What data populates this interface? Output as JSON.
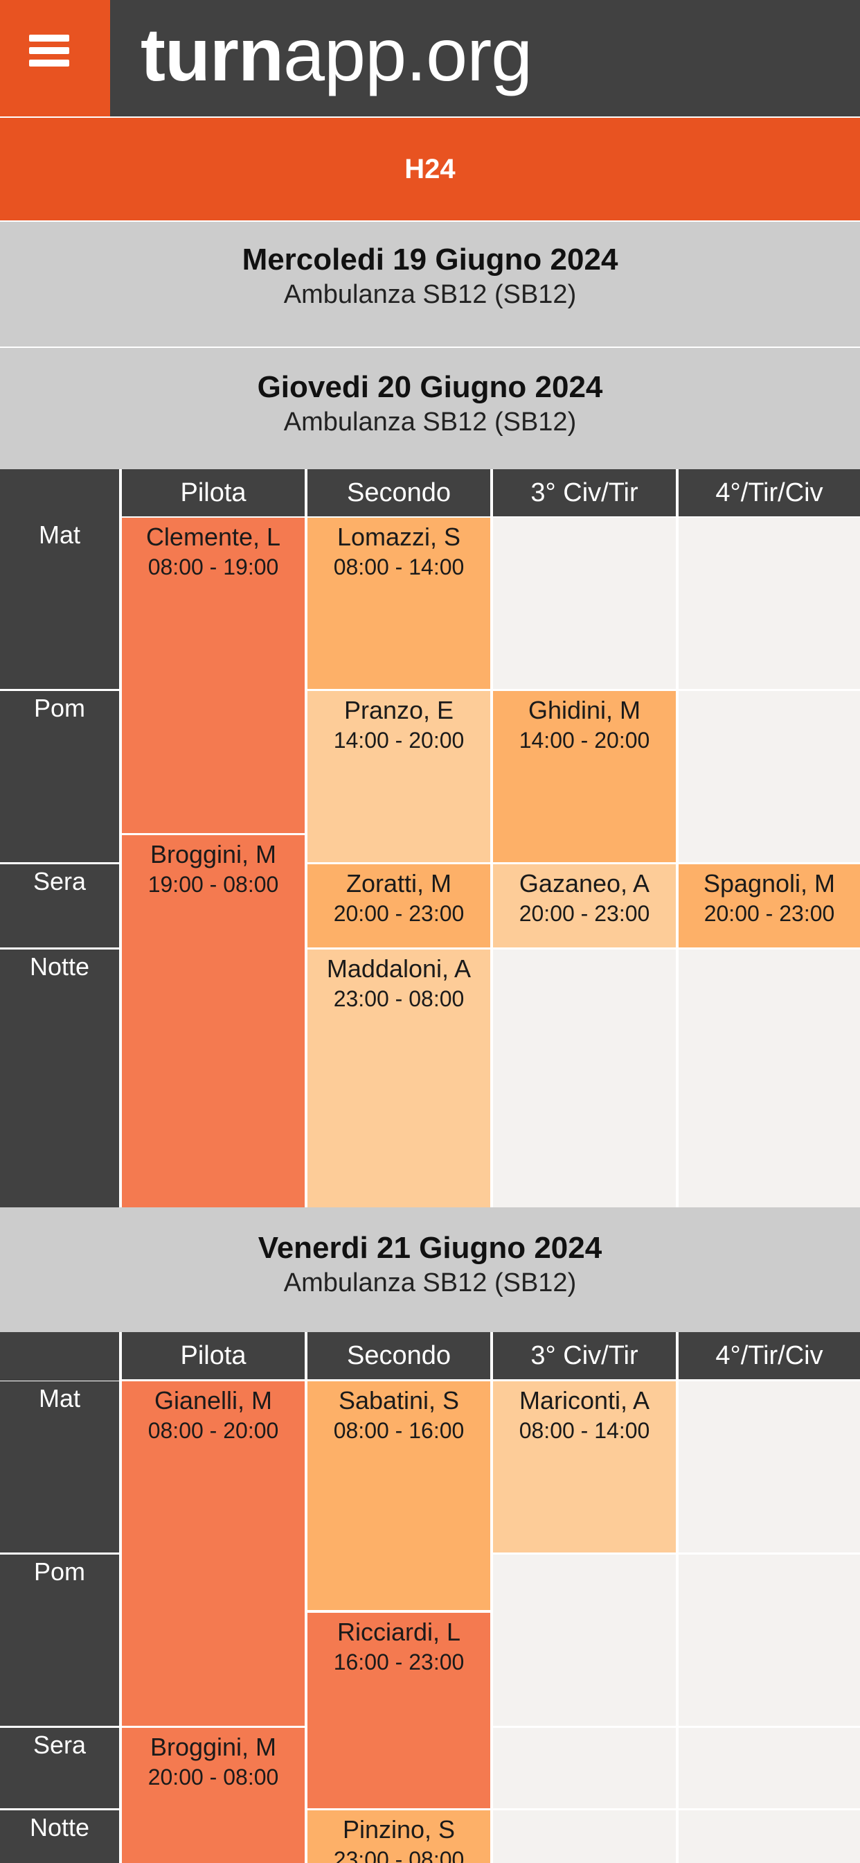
{
  "header": {
    "logo_bold": "turn",
    "logo_light": "app.org",
    "menu_icon": "hamburger-icon"
  },
  "band": {
    "title": "H24"
  },
  "columns": [
    "Pilota",
    "Secondo",
    "3° Civ/Tir",
    "4°/Tir/Civ"
  ],
  "rows": [
    "Mat",
    "Pom",
    "Sera",
    "Notte"
  ],
  "colors": {
    "brand": "#e85321",
    "bar": "#414141",
    "shift_red": "#f47a50",
    "shift_orange": "#fdb068",
    "shift_light": "#fdcc98",
    "empty": "#f4f2f0",
    "day_header": "#cccccc"
  },
  "days": [
    {
      "title": "Mercoledi 19 Giugno 2024",
      "vehicle": "Ambulanza SB12 (SB12)"
    },
    {
      "title": "Giovedi 20 Giugno 2024",
      "vehicle": "Ambulanza SB12 (SB12)",
      "shifts": [
        {
          "name": "Clemente, L",
          "time": "08:00 - 19:00"
        },
        {
          "name": "Broggini, M",
          "time": "19:00 - 08:00"
        },
        {
          "name": "Lomazzi, S",
          "time": "08:00 - 14:00"
        },
        {
          "name": "Pranzo, E",
          "time": "14:00 - 20:00"
        },
        {
          "name": "Zoratti, M",
          "time": "20:00 - 23:00"
        },
        {
          "name": "Maddaloni, A",
          "time": "23:00 - 08:00"
        },
        {
          "name": "Ghidini, M",
          "time": "14:00 - 20:00"
        },
        {
          "name": "Gazaneo, A",
          "time": "20:00 - 23:00"
        },
        {
          "name": "Spagnoli, M",
          "time": "20:00 - 23:00"
        }
      ]
    },
    {
      "title": "Venerdi 21 Giugno 2024",
      "vehicle": "Ambulanza SB12 (SB12)",
      "shifts": [
        {
          "name": "Gianelli, M",
          "time": "08:00 - 20:00"
        },
        {
          "name": "Broggini, M",
          "time": "20:00 - 08:00"
        },
        {
          "name": "Sabatini, S",
          "time": "08:00 - 16:00"
        },
        {
          "name": "Ricciardi, L",
          "time": "16:00 - 23:00"
        },
        {
          "name": "Pinzino, S",
          "time": "23:00 - 08:00"
        },
        {
          "name": "Mariconti, A",
          "time": "08:00 - 14:00"
        }
      ]
    }
  ]
}
